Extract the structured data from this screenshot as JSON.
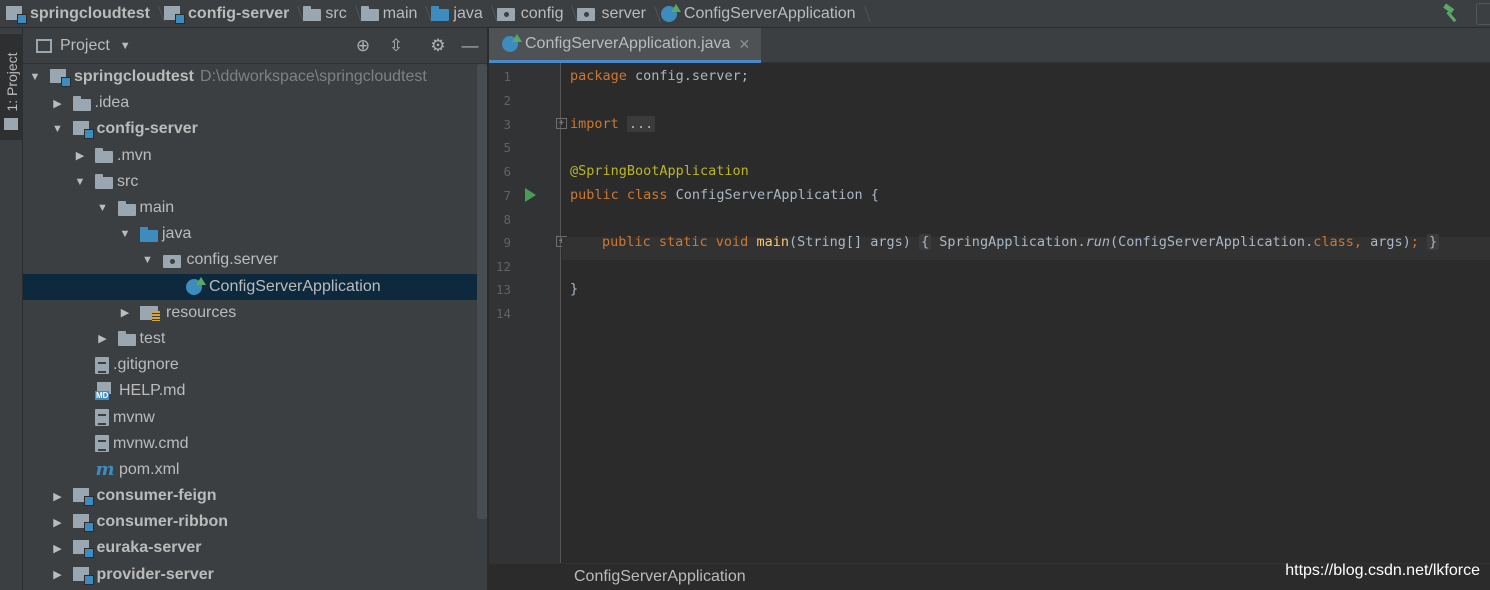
{
  "breadcrumbs": [
    {
      "label": "springcloudtest",
      "icon": "module-icon",
      "bold": true
    },
    {
      "label": "config-server",
      "icon": "module-icon",
      "bold": true
    },
    {
      "label": "src",
      "icon": "folder-icon",
      "bold": false
    },
    {
      "label": "main",
      "icon": "folder-icon",
      "bold": false
    },
    {
      "label": "java",
      "icon": "source-folder-icon",
      "bold": false
    },
    {
      "label": "config",
      "icon": "package-icon",
      "bold": false
    },
    {
      "label": "server",
      "icon": "package-icon",
      "bold": false
    },
    {
      "label": "ConfigServerApplication",
      "icon": "spring-boot-class-icon",
      "bold": false
    }
  ],
  "toolstrip": {
    "project_tab": "1: Project"
  },
  "project_panel": {
    "title": "Project",
    "tree": [
      {
        "depth": 0,
        "arrow": "down",
        "icon": "module",
        "label": "springcloudtest",
        "bold": true,
        "path": "D:\\ddworkspace\\springcloudtest"
      },
      {
        "depth": 1,
        "arrow": "right",
        "icon": "folder",
        "label": ".idea"
      },
      {
        "depth": 1,
        "arrow": "down",
        "icon": "module",
        "label": "config-server",
        "bold": true
      },
      {
        "depth": 2,
        "arrow": "right",
        "icon": "folder",
        "label": ".mvn"
      },
      {
        "depth": 2,
        "arrow": "down",
        "icon": "folder",
        "label": "src"
      },
      {
        "depth": 3,
        "arrow": "down",
        "icon": "folder",
        "label": "main"
      },
      {
        "depth": 4,
        "arrow": "down",
        "icon": "folder-blue",
        "label": "java"
      },
      {
        "depth": 5,
        "arrow": "down",
        "icon": "package",
        "label": "config.server"
      },
      {
        "depth": 6,
        "arrow": "none",
        "icon": "class",
        "label": "ConfigServerApplication",
        "selected": true
      },
      {
        "depth": 4,
        "arrow": "right",
        "icon": "resources",
        "label": "resources"
      },
      {
        "depth": 3,
        "arrow": "right",
        "icon": "folder",
        "label": "test"
      },
      {
        "depth": 2,
        "arrow": "none",
        "icon": "file",
        "label": ".gitignore"
      },
      {
        "depth": 2,
        "arrow": "none",
        "icon": "md",
        "label": "HELP.md"
      },
      {
        "depth": 2,
        "arrow": "none",
        "icon": "file",
        "label": "mvnw"
      },
      {
        "depth": 2,
        "arrow": "none",
        "icon": "file",
        "label": "mvnw.cmd"
      },
      {
        "depth": 2,
        "arrow": "none",
        "icon": "maven",
        "label": "pom.xml"
      },
      {
        "depth": 1,
        "arrow": "right",
        "icon": "module",
        "label": "consumer-feign",
        "bold": true
      },
      {
        "depth": 1,
        "arrow": "right",
        "icon": "module",
        "label": "consumer-ribbon",
        "bold": true
      },
      {
        "depth": 1,
        "arrow": "right",
        "icon": "module",
        "label": "euraka-server",
        "bold": true
      },
      {
        "depth": 1,
        "arrow": "right",
        "icon": "module",
        "label": "provider-server",
        "bold": true
      }
    ]
  },
  "editor": {
    "tab_label": "ConfigServerApplication.java",
    "line_numbers": [
      "1",
      "2",
      "3",
      "5",
      "6",
      "7",
      "8",
      "9",
      "12",
      "13",
      "14"
    ],
    "code": {
      "pkg_kw": "package",
      "pkg_name": " config.server;",
      "import_kw": "import",
      "import_fold": "...",
      "annotation": "@SpringBootApplication",
      "class_kw": "public class",
      "class_name": " ConfigServerApplication {",
      "main_kw": "public static void",
      "main_name": "main",
      "main_params": "(String[] args)",
      "body_open": "{",
      "body_call": " SpringApplication.",
      "body_run": "run",
      "body_args": "(ConfigServerApplication.",
      "body_class_kw": "class,",
      "body_tail": " args)",
      "body_semi": ";",
      "body_close": "}",
      "close_brace": "}"
    },
    "bottom_breadcrumb": "ConfigServerApplication"
  },
  "watermark": "https://blog.csdn.net/lkforce",
  "colors": {
    "keyword": "#cc7832",
    "annotation": "#bbb529",
    "method": "#ffc66d",
    "text": "#a9b7c6",
    "selection": "#0d293e",
    "accent": "#4a88c7"
  }
}
